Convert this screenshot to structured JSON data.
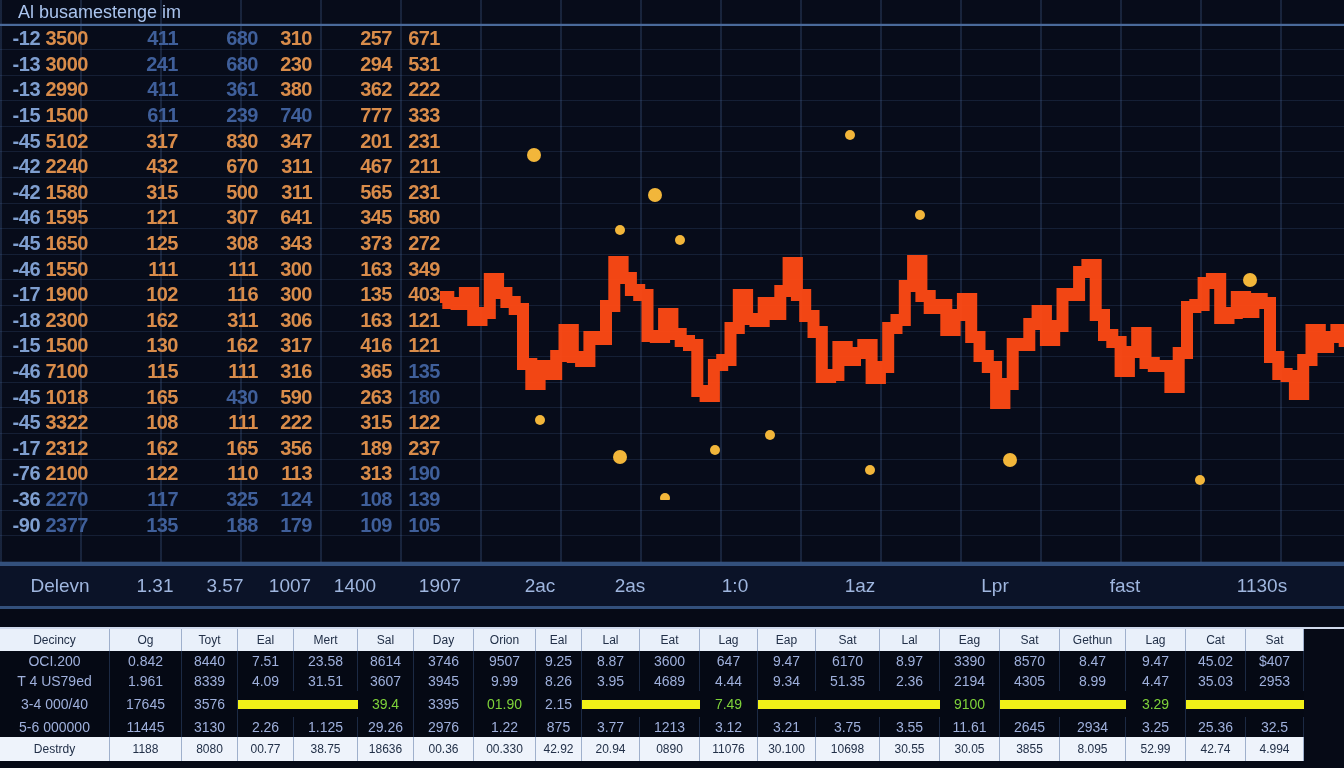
{
  "title": "Al busamestenge im",
  "ticker": {
    "rows": [
      {
        "cells": [
          "-12",
          "3500",
          "411",
          "680",
          "310",
          "257",
          "671"
        ],
        "dim": [
          true,
          false,
          true,
          true,
          false,
          false,
          false
        ]
      },
      {
        "cells": [
          "-13",
          "3000",
          "241",
          "680",
          "230",
          "294",
          "531"
        ],
        "dim": [
          true,
          false,
          true,
          true,
          false,
          false,
          false
        ]
      },
      {
        "cells": [
          "-13",
          "2990",
          "411",
          "361",
          "380",
          "362",
          "222"
        ],
        "dim": [
          true,
          false,
          true,
          true,
          false,
          false,
          false
        ]
      },
      {
        "cells": [
          "-15",
          "1500",
          "611",
          "239",
          "740",
          "777",
          "333"
        ],
        "dim": [
          true,
          false,
          true,
          true,
          true,
          false,
          false
        ]
      },
      {
        "cells": [
          "-45",
          "5102",
          "317",
          "830",
          "347",
          "201",
          "231"
        ],
        "dim": [
          true,
          false,
          false,
          false,
          false,
          false,
          false
        ]
      },
      {
        "cells": [
          "-42",
          "2240",
          "432",
          "670",
          "311",
          "467",
          "211"
        ],
        "dim": [
          true,
          false,
          false,
          false,
          false,
          false,
          false
        ]
      },
      {
        "cells": [
          "-42",
          "1580",
          "315",
          "500",
          "311",
          "565",
          "231"
        ],
        "dim": [
          true,
          false,
          false,
          false,
          false,
          false,
          false
        ]
      },
      {
        "cells": [
          "-46",
          "1595",
          "121",
          "307",
          "641",
          "345",
          "580"
        ],
        "dim": [
          true,
          false,
          false,
          false,
          false,
          false,
          false
        ]
      },
      {
        "cells": [
          "-45",
          "1650",
          "125",
          "308",
          "343",
          "373",
          "272"
        ],
        "dim": [
          true,
          false,
          false,
          false,
          false,
          false,
          false
        ]
      },
      {
        "cells": [
          "-46",
          "1550",
          "111",
          "111",
          "300",
          "163",
          "349"
        ],
        "dim": [
          true,
          false,
          false,
          false,
          false,
          false,
          false
        ]
      },
      {
        "cells": [
          "-17",
          "1900",
          "102",
          "116",
          "300",
          "135",
          "403"
        ],
        "dim": [
          true,
          false,
          false,
          false,
          false,
          false,
          false
        ]
      },
      {
        "cells": [
          "-18",
          "2300",
          "162",
          "311",
          "306",
          "163",
          "121"
        ],
        "dim": [
          true,
          false,
          false,
          false,
          false,
          false,
          false
        ]
      },
      {
        "cells": [
          "-15",
          "1500",
          "130",
          "162",
          "317",
          "416",
          "121"
        ],
        "dim": [
          true,
          false,
          false,
          false,
          false,
          false,
          false
        ]
      },
      {
        "cells": [
          "-46",
          "7100",
          "115",
          "111",
          "316",
          "365",
          "135"
        ],
        "dim": [
          true,
          false,
          false,
          false,
          false,
          false,
          true
        ]
      },
      {
        "cells": [
          "-45",
          "1018",
          "165",
          "430",
          "590",
          "263",
          "180"
        ],
        "dim": [
          true,
          false,
          false,
          true,
          false,
          false,
          true
        ]
      },
      {
        "cells": [
          "-45",
          "3322",
          "108",
          "111",
          "222",
          "315",
          "122"
        ],
        "dim": [
          true,
          false,
          false,
          false,
          false,
          false,
          false
        ]
      },
      {
        "cells": [
          "-17",
          "2312",
          "162",
          "165",
          "356",
          "189",
          "237"
        ],
        "dim": [
          true,
          false,
          false,
          false,
          false,
          false,
          false
        ]
      },
      {
        "cells": [
          "-76",
          "2100",
          "122",
          "110",
          "113",
          "313",
          "190"
        ],
        "dim": [
          true,
          false,
          false,
          false,
          false,
          false,
          true
        ]
      },
      {
        "cells": [
          "-36",
          "2270",
          "117",
          "325",
          "124",
          "108",
          "139"
        ],
        "dim": [
          true,
          true,
          true,
          true,
          true,
          true,
          true
        ]
      },
      {
        "cells": [
          "-90",
          "2377",
          "135",
          "188",
          "179",
          "109",
          "105"
        ],
        "dim": [
          true,
          true,
          true,
          true,
          true,
          true,
          true
        ]
      }
    ]
  },
  "axis_labels": [
    "Delevn",
    "1.31",
    "3.57",
    "1007",
    "1400",
    "1907",
    "2ac",
    "2as",
    "1:0",
    "1az",
    "Lpr",
    "fast",
    "1130s"
  ],
  "table": {
    "columns": [
      "Decincy",
      "Og",
      "Toyt",
      "Eal",
      "Mert",
      "Sal",
      "Day",
      "Orion",
      "Eal",
      "Lal",
      "Eat",
      "Lag",
      "Eap",
      "Sat",
      "Lal",
      "Eag",
      "Sat",
      "Gethun",
      "Lag",
      "Cat",
      "Sat"
    ],
    "rows": [
      [
        "OCI.200",
        "0.842",
        "8440",
        "7.51",
        "23.58",
        "8614",
        "3746",
        "9507",
        "9.25",
        "8.87",
        "3600",
        "647",
        "9.47",
        "6170",
        "8.97",
        "3390",
        "8570",
        "8.47",
        "9.47",
        "45.02",
        "$407"
      ],
      [
        "T 4 US79ed",
        "1.961",
        "8339",
        "4.09",
        "31.51",
        "3607",
        "3945",
        "9.99",
        "8.26",
        "3.95",
        "4689",
        "4.44",
        "9.34",
        "51.35",
        "2.36",
        "2194",
        "4305",
        "8.99",
        "4.47",
        "35.03",
        "2953"
      ],
      [
        "3-4 000/40",
        "17645",
        "3576",
        {
          "kind": "highlight"
        },
        {
          "kind": "highlight"
        },
        {
          "kind": "up",
          "text": "39.4"
        },
        "3395",
        {
          "kind": "up",
          "text": "01.90"
        },
        "2.15",
        {
          "kind": "highlight"
        },
        {
          "kind": "highlight"
        },
        {
          "kind": "up",
          "text": "7.49"
        },
        {
          "kind": "highlight"
        },
        {
          "kind": "highlight"
        },
        {
          "kind": "highlight"
        },
        {
          "kind": "up",
          "text": "9100"
        },
        {
          "kind": "highlight"
        },
        {
          "kind": "highlight"
        },
        {
          "kind": "up",
          "text": "3.29"
        },
        {
          "kind": "highlight"
        },
        {
          "kind": "highlight"
        }
      ],
      [
        "5-6 000000",
        "11445",
        "3130",
        "2.26",
        "1.125",
        "29.26",
        "2976",
        "1.22",
        "875",
        "3.77",
        "1213",
        "3.12",
        "3.21",
        "3.75",
        "3.55",
        "11.61",
        "2645",
        "2934",
        "3.25",
        "25.36",
        "32.5"
      ]
    ],
    "footer": [
      "Destrdy",
      "1188",
      "8080",
      "00.77",
      "38.75",
      "18636",
      "00.36",
      "00.330",
      "42.92",
      "20.94",
      "0890",
      "11076",
      "30.100",
      "10698",
      "30.55",
      "30.05",
      "3855",
      "8.095",
      "52.99",
      "42.74",
      "4.994"
    ]
  }
}
